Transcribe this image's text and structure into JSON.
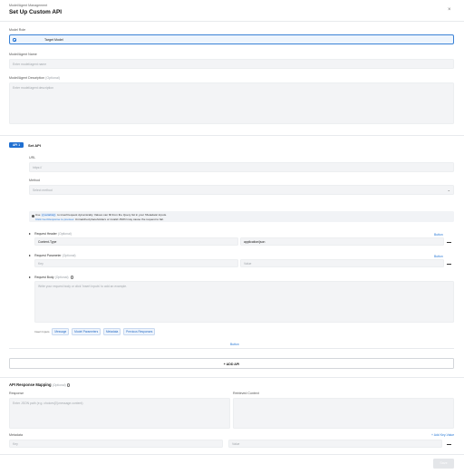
{
  "header": {
    "breadcrumb": "Model/Agent Management",
    "title": "Set Up Custom API"
  },
  "model_role": {
    "label": "Model Role",
    "selected": "Target Model"
  },
  "name_field": {
    "label": "Model/Agent Name",
    "placeholder": "Enter model/agent name"
  },
  "description_field": {
    "label": "Model/Agent Description",
    "optional": "(Optional)",
    "placeholder": "Enter model/agent description"
  },
  "api": {
    "badge": "API 1",
    "title": "Set API",
    "url_label": "URL",
    "url_placeholder": "https://",
    "method_label": "Method",
    "method_placeholder": "Select method",
    "info_line1_prefix": "Use",
    "info_variable": "{{variable}}",
    "info_line1_suffix": "to insert/request dynamically. Values can fill from the Query list in your 'Metadata' inputs.",
    "info_line2_link": "Click Get Response to preview.",
    "info_line2_suffix": "Unmatched placeholders or invalid JSON may cause the request to fail.",
    "request_header_label": "Request Header",
    "request_header_optional": "(Optional)",
    "header_button": "Button",
    "header_key": "Content-Type",
    "header_value": "application/json",
    "request_param_label": "Request Parameter",
    "request_param_optional": "(Optional)",
    "param_button": "Button",
    "param_key_placeholder": "Key",
    "param_value_placeholder": "Value",
    "request_body_label": "Request Body",
    "request_body_optional": "(Optional)",
    "body_placeholder": "Write your request body or click 'Insert Inputs' to add an example.",
    "insert_inputs_label": "Insert Inputs",
    "insert_chips": [
      "Message",
      "Model Parameters",
      "Metadata",
      "Previous Responses"
    ],
    "body_button": "Button",
    "add_api": "+ ADD API"
  },
  "mapping": {
    "title": "API Response Mapping",
    "optional": "(Optional)",
    "response_label": "Response",
    "response_placeholder": "Enter JSON path (e.g. choices[0].message.content)",
    "retrieved_label": "Retrieved Context",
    "metadata_label": "Metadata",
    "add_key_value": "+ Add Key-Value",
    "key_placeholder": "Key",
    "value_placeholder": "Value"
  },
  "footer": {
    "save_label": "Save"
  },
  "colors": {
    "accent": "#1f6fd1",
    "input_bg": "#f3f4f6"
  }
}
